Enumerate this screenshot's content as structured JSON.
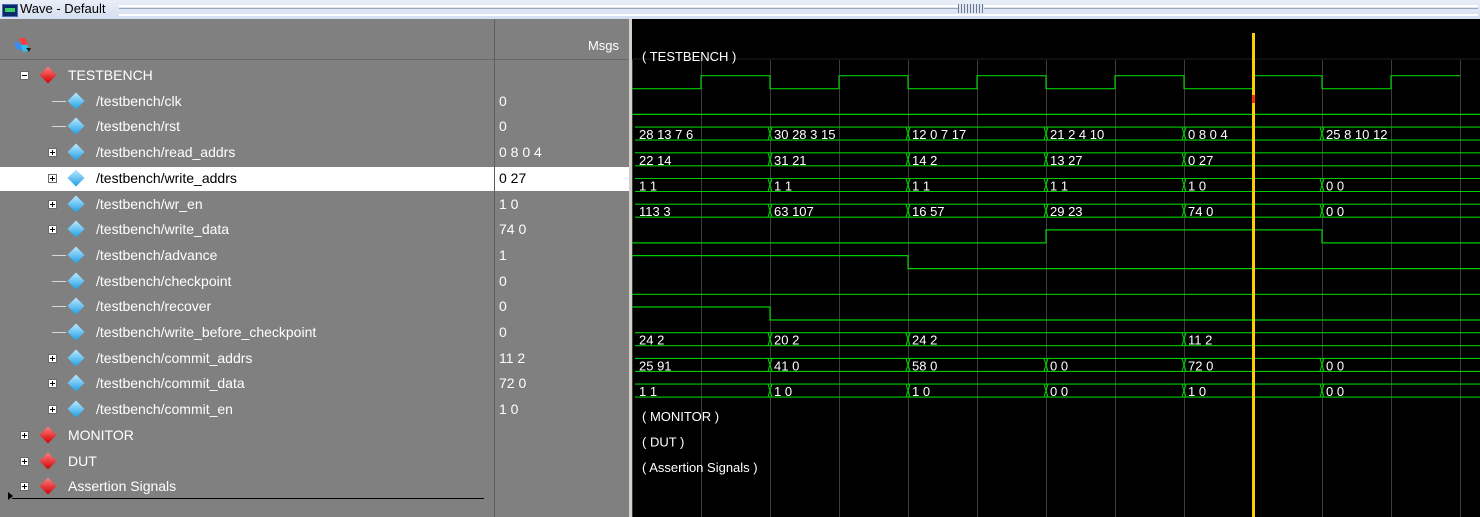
{
  "window": {
    "title": "Wave - Default"
  },
  "columns": {
    "msgs": "Msgs"
  },
  "rows": [
    {
      "id": "tb",
      "name": "TESTBENCH",
      "level": 0,
      "kind": "group",
      "expanded": true,
      "value": "",
      "segments": []
    },
    {
      "id": "clk",
      "name": "/testbench/clk",
      "level": 1,
      "kind": "bit",
      "value": "0",
      "bits": [
        0,
        1,
        0,
        1,
        0,
        1,
        0,
        1,
        0,
        1,
        0,
        1
      ]
    },
    {
      "id": "rst",
      "name": "/testbench/rst",
      "level": 1,
      "kind": "bit",
      "value": "0",
      "bits": [
        0
      ]
    },
    {
      "id": "read_addrs",
      "name": "/testbench/read_addrs",
      "level": 1,
      "kind": "bus",
      "expandable": true,
      "value": "0 8 0 4",
      "segments": [
        "28 13 7 6",
        "30 28 3 15",
        "12 0 7 17",
        "21 2 4 10",
        "0 8 0 4",
        "25 8 10 12"
      ]
    },
    {
      "id": "write_addrs",
      "name": "/testbench/write_addrs",
      "level": 1,
      "kind": "bus",
      "expandable": true,
      "selected": true,
      "value": "0 27",
      "segments": [
        "22 14",
        "31 21",
        "14 2",
        "13 27",
        "0 27",
        ""
      ]
    },
    {
      "id": "wr_en",
      "name": "/testbench/wr_en",
      "level": 1,
      "kind": "bus",
      "expandable": true,
      "value": "1 0",
      "segments": [
        "1 1",
        "1 1",
        "1 1",
        "1 1",
        "1 0",
        "0 0"
      ]
    },
    {
      "id": "write_data",
      "name": "/testbench/write_data",
      "level": 1,
      "kind": "bus",
      "expandable": true,
      "value": "74 0",
      "segments": [
        "113 3",
        "63 107",
        "16 57",
        "29 23",
        "74 0",
        "0 0"
      ]
    },
    {
      "id": "advance",
      "name": "/testbench/advance",
      "level": 1,
      "kind": "bit",
      "value": "1",
      "bits": [
        0,
        0,
        0,
        1,
        1,
        0
      ]
    },
    {
      "id": "checkpoint",
      "name": "/testbench/checkpoint",
      "level": 1,
      "kind": "bit",
      "value": "0",
      "bits": [
        1,
        1,
        0,
        0,
        0,
        0
      ]
    },
    {
      "id": "recover",
      "name": "/testbench/recover",
      "level": 1,
      "kind": "bit",
      "value": "0",
      "bits": [
        0
      ]
    },
    {
      "id": "wbc",
      "name": "/testbench/write_before_checkpoint",
      "level": 1,
      "kind": "bit",
      "value": "0",
      "bits": [
        1,
        0,
        0,
        0,
        0,
        0
      ]
    },
    {
      "id": "commit_addrs",
      "name": "/testbench/commit_addrs",
      "level": 1,
      "kind": "bus",
      "expandable": true,
      "value": "11 2",
      "segments": [
        "24 2",
        "20 2",
        "24 2",
        "",
        "11 2",
        ""
      ]
    },
    {
      "id": "commit_data",
      "name": "/testbench/commit_data",
      "level": 1,
      "kind": "bus",
      "expandable": true,
      "value": "72 0",
      "segments": [
        "25 91",
        "41 0",
        "58 0",
        "0 0",
        "72 0",
        "0 0"
      ]
    },
    {
      "id": "commit_en",
      "name": "/testbench/commit_en",
      "level": 1,
      "kind": "bus",
      "expandable": true,
      "value": "1 0",
      "segments": [
        "1 1",
        "1 0",
        "1 0",
        "0 0",
        "1 0",
        "0 0"
      ]
    },
    {
      "id": "mon",
      "name": "MONITOR",
      "level": 0,
      "kind": "group",
      "expanded": false,
      "value": ""
    },
    {
      "id": "dut",
      "name": "DUT",
      "level": 0,
      "kind": "group",
      "expanded": false,
      "value": ""
    },
    {
      "id": "as",
      "name": "Assertion Signals",
      "level": 0,
      "kind": "group",
      "expanded": false,
      "value": ""
    }
  ],
  "wave_group_labels": {
    "tb": "( TESTBENCH )",
    "mon": "( MONITOR )",
    "dut": "( DUT )",
    "as": "( Assertion Signals )"
  },
  "colors": {
    "signal": "#00cc00",
    "cursor": "#ffd000",
    "grid": "#404040",
    "selected_row": "#ffffff"
  },
  "icons": {
    "group": "red-diamond-icon",
    "signal": "blue-diamond-icon",
    "toolbar": "wave-tool-icon"
  }
}
